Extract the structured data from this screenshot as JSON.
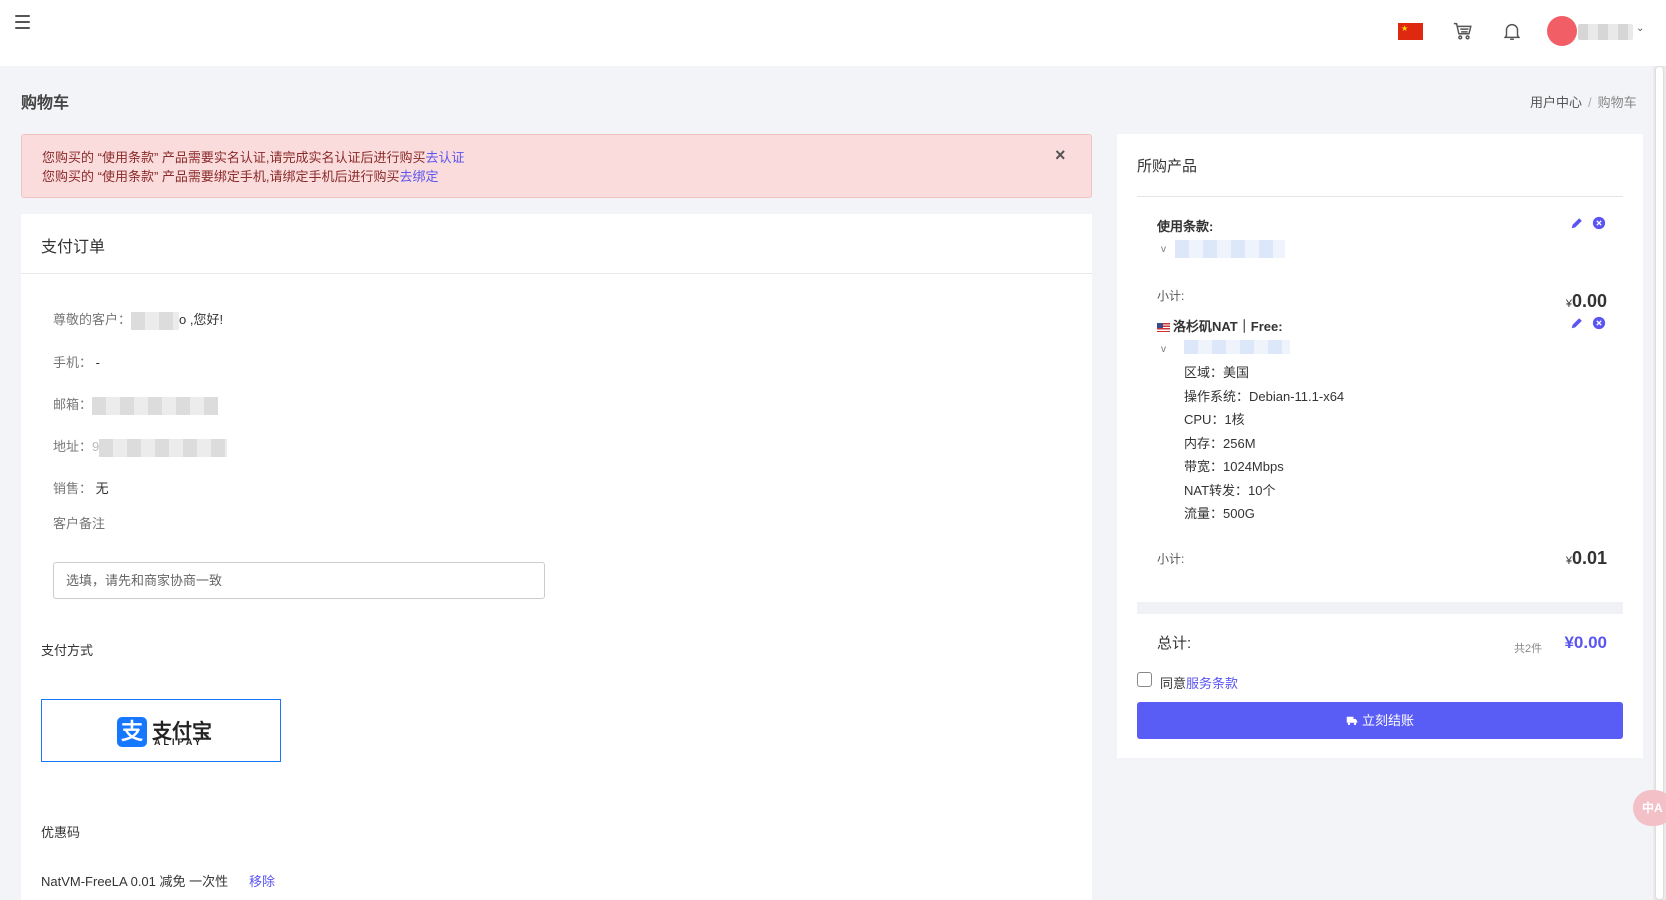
{
  "colors": {
    "accent": "#5a5cf6",
    "alert_bg": "#fadcdc",
    "alipay_blue": "#1677ff"
  },
  "header": {
    "icons": [
      "menu-icon",
      "china-flag-icon",
      "cart-icon",
      "bell-icon",
      "avatar"
    ]
  },
  "page": {
    "title": "购物车"
  },
  "breadcrumb": {
    "home": "用户中心",
    "sep": "/",
    "current": "购物车"
  },
  "alert": {
    "line1_text": "您购买的 “使用条款” 产品需要实名认证,请完成实名认证后进行购买",
    "line1_link": "去认证",
    "line2_text": "您购买的 “使用条款” 产品需要绑定手机,请绑定手机后进行购买",
    "line2_link": "去绑定",
    "close": "×"
  },
  "order": {
    "title": "支付订单",
    "greeting_label": "尊敬的客户：",
    "greeting_suffix": "o ,您好!",
    "phone_label": "手机：",
    "phone_value": "-",
    "email_label": "邮箱：",
    "address_label": "地址：",
    "address_prefix": "9",
    "sales_label": "销售：",
    "sales_value": "无",
    "remark_label": "客户备注",
    "remark_placeholder": "选填，请先和商家协商一致",
    "payment_label": "支付方式",
    "alipay": {
      "logo_char": "支",
      "cn": "支付宝",
      "en": "ALIPAY"
    },
    "coupon_label": "优惠码",
    "coupon_value": "NatVM-FreeLA 0.01 减免 一次性",
    "coupon_remove": "移除"
  },
  "cart": {
    "title": "所购产品",
    "items": [
      {
        "name": "使用条款:",
        "caret": "v",
        "subtotal_label": "小计:",
        "subtotal_currency": "¥",
        "subtotal_amount": "0.00"
      },
      {
        "name": "洛杉矶NAT｜Free:",
        "caret": "v",
        "specs": [
          "区域：美国",
          "操作系统：Debian-11.1-x64",
          "CPU：1核",
          "内存：256M",
          "带宽：1024Mbps",
          "NAT转发：10个",
          "流量：500G"
        ],
        "subtotal_label": "小计:",
        "subtotal_currency": "¥",
        "subtotal_amount": "0.01"
      }
    ],
    "total_label": "总计:",
    "total_count": "共2件",
    "total_value": "¥0.00",
    "agree_prefix": "同意",
    "agree_link": "服务条款",
    "checkout_label": "立刻结账"
  },
  "translate_fab": {
    "label": "中A"
  }
}
